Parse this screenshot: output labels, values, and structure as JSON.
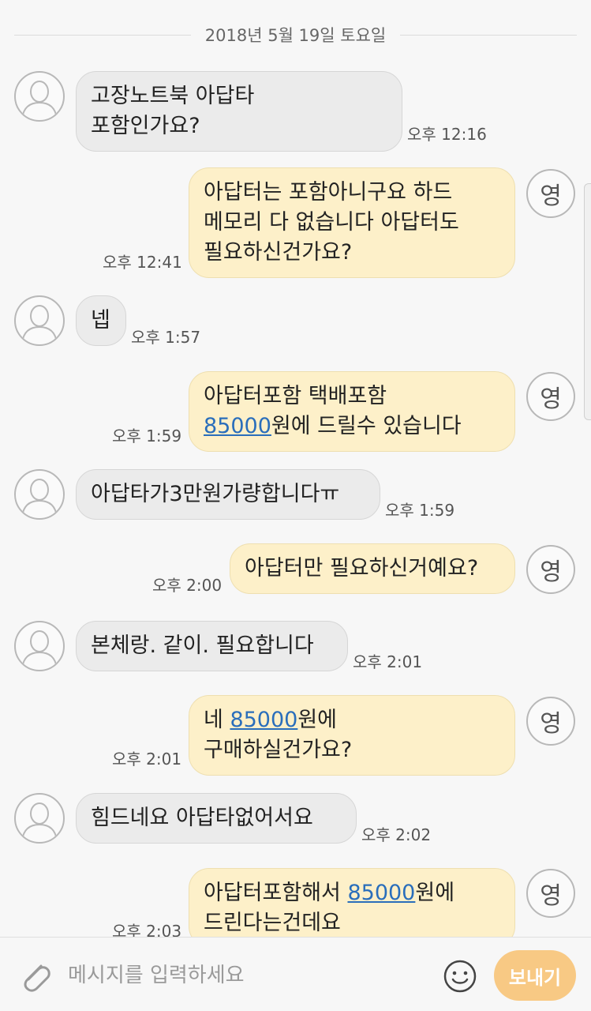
{
  "date_divider": "2018년 5월 19일 토요일",
  "me_badge": "영",
  "messages": [
    {
      "dir": "in",
      "lines": [
        "고장노트북 아답타",
        "포함인가요?"
      ],
      "time": "오후 12:16"
    },
    {
      "dir": "out",
      "lines": [
        "아답터는 포함아니구요 하드",
        "메모리 다 없습니다  아답터도",
        "필요하신건가요?"
      ],
      "time": "오후 12:41"
    },
    {
      "dir": "in",
      "lines": [
        "넵"
      ],
      "time": "오후 1:57"
    },
    {
      "dir": "out",
      "lines": [
        "아답터포함 택배포함"
      ],
      "price": "85000",
      "line2_suffix": "원에 드릴수 있습니다",
      "time": "오후 1:59"
    },
    {
      "dir": "in",
      "lines": [
        "아답타가3만원가량합니다ㅠ"
      ],
      "time": "오후 1:59"
    },
    {
      "dir": "out",
      "lines": [
        "아답터만 필요하신거예요?"
      ],
      "time": "오후 2:00"
    },
    {
      "dir": "in",
      "lines": [
        "본체랑. 같이. 필요합니다"
      ],
      "time": "오후 2:01"
    },
    {
      "dir": "out",
      "line1_prefix": "네 ",
      "price": "85000",
      "line1_suffix": "원에",
      "lines": [
        "구매하실건가요?"
      ],
      "time": "오후 2:01"
    },
    {
      "dir": "in",
      "lines": [
        "힘드네요 아답타없어서요"
      ],
      "time": "오후 2:02"
    },
    {
      "dir": "out",
      "line1_prefix": "아답터포함해서 ",
      "price": "85000",
      "line1_suffix": "원에",
      "lines": [
        "드린다는건데요"
      ],
      "time": "오후 2:03"
    }
  ],
  "input": {
    "placeholder": "메시지를 입력하세요",
    "value": ""
  },
  "send_label": "보내기",
  "icons": {
    "attach": "paperclip-icon",
    "emoji": "smiley-icon",
    "avatar": "person-silhouette-icon"
  },
  "colors": {
    "incoming_bubble": "#ebebeb",
    "outgoing_bubble": "#fdf0c9",
    "send_button": "#f8c984",
    "link": "#2a6ebb"
  }
}
